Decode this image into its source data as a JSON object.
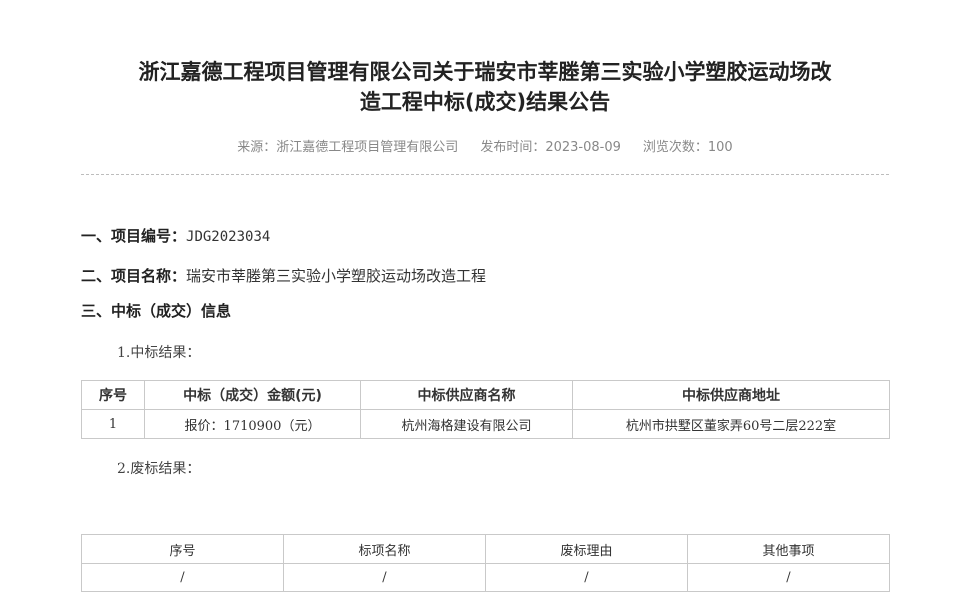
{
  "article": {
    "title_line1": "浙江嘉德工程项目管理有限公司关于瑞安市莘塍第三实验小学塑胶运动场改",
    "title_line2": "造工程中标(成交)结果公告",
    "meta": {
      "source": "来源：浙江嘉德工程项目管理有限公司",
      "publish_time": "发布时间：2023-08-09",
      "views": "浏览次数：100"
    }
  },
  "sections": {
    "project_no_label": "一、项目编号：",
    "project_no_value": "JDG2023034",
    "project_name_label": "二、项目名称：",
    "project_name_value": "瑞安市莘塍第三实验小学塑胶运动场改造工程",
    "award_info_label": "三、中标（成交）信息",
    "award_result_label": "1.中标结果：",
    "failed_result_label": "2.废标结果："
  },
  "award_table": {
    "headers": [
      "序号",
      "中标（成交）金额(元)",
      "中标供应商名称",
      "中标供应商地址"
    ],
    "rows": [
      [
        "1",
        "报价：1710900（元）",
        "杭州海格建设有限公司",
        "杭州市拱墅区董家弄60号二层222室"
      ]
    ]
  },
  "failed_table": {
    "headers": [
      "序号",
      "标项名称",
      "废标理由",
      "其他事项"
    ],
    "rows": [
      [
        "/",
        "/",
        "/",
        "/"
      ]
    ]
  }
}
